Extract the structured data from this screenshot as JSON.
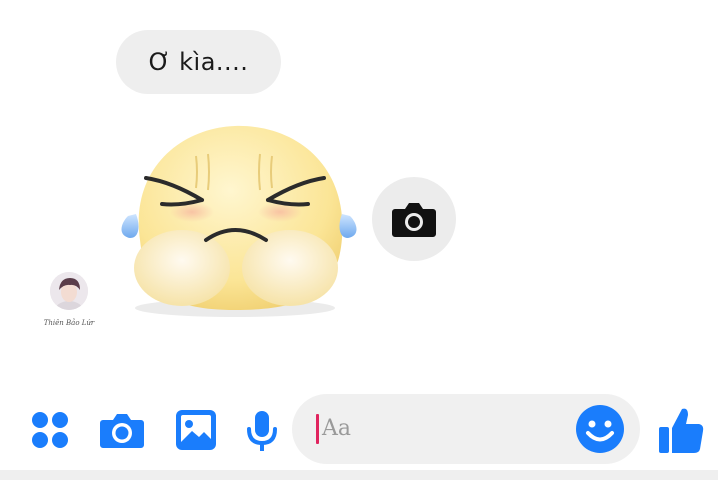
{
  "colors": {
    "accent": "#1a7dfc",
    "bubble_bg": "#eeeeee",
    "composer_bg": "#f0f0f0",
    "caret": "#e0245e"
  },
  "messages": [
    {
      "sender": "other",
      "text": "Ơ kìa...."
    }
  ],
  "sticker": {
    "icon": "crying-blob-sticker"
  },
  "camera_button": {
    "icon": "camera-icon"
  },
  "avatar": {
    "caption": "Thiên Bảo Lứr"
  },
  "toolbar": {
    "items": [
      {
        "icon": "menu-dots-icon"
      },
      {
        "icon": "camera-icon"
      },
      {
        "icon": "image-icon"
      },
      {
        "icon": "microphone-icon"
      }
    ]
  },
  "composer": {
    "placeholder": "Aa",
    "emoji_icon": "smile-icon"
  },
  "like_button": {
    "icon": "thumbs-up-icon"
  }
}
